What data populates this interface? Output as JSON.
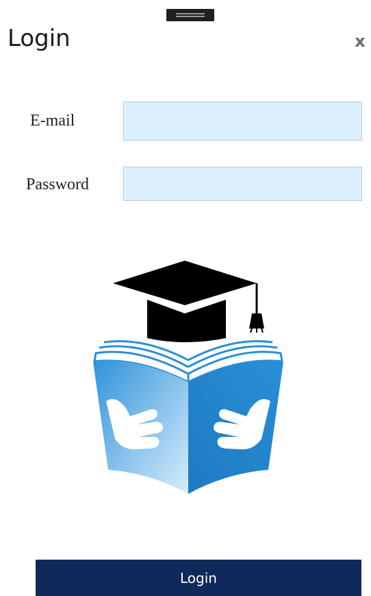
{
  "header": {
    "title": "Login",
    "close_glyph": "x"
  },
  "form": {
    "email_label": "E-mail",
    "email_value": "",
    "password_label": "Password",
    "password_value": "",
    "login_label": "Login"
  },
  "icons": {
    "drag": "drag-handle-icon",
    "close": "close-icon",
    "logo": "graduation-cap-book-hands-logo"
  },
  "colors": {
    "input_bg": "#dcefff",
    "button_bg": "#0f2a5a",
    "book_blue": "#2a8fd6"
  }
}
